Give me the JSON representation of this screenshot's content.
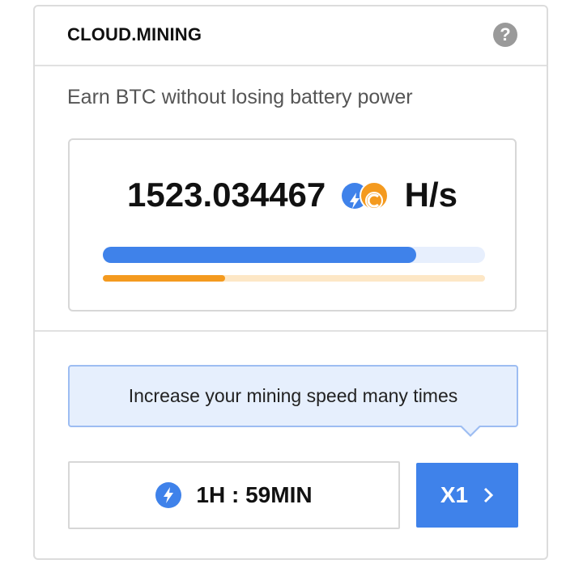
{
  "header": {
    "title": "CLOUD.MINING",
    "help_icon": "question-mark-icon"
  },
  "subtitle": "Earn BTC without losing battery power",
  "hashrate": {
    "value": "1523.034467",
    "unit": "H/s",
    "icons": [
      "lightning-bolt-icon",
      "coin-c-icon"
    ],
    "primary_progress": 0.82,
    "secondary_progress": 0.32
  },
  "boost_tip": "Increase your mining speed many times",
  "timer": {
    "icon": "lightning-bolt-icon",
    "text": "1H : 59MIN"
  },
  "multiplier": {
    "label": "X1",
    "icon": "chevron-right-icon"
  },
  "colors": {
    "accent_blue": "#3f82ea",
    "accent_orange": "#f49a1f",
    "tip_bg": "#e6effd",
    "help_gray": "#9a9a9a"
  }
}
